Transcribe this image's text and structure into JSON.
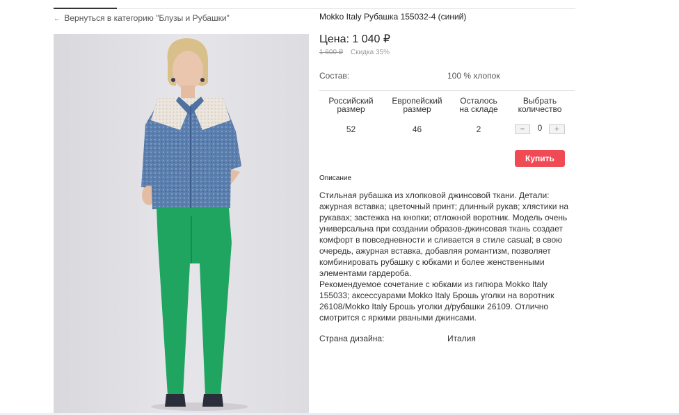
{
  "navigation": {
    "back_arrow": "←",
    "back_label": "Вернуться в категорию \"Блузы и Рубашки\""
  },
  "product": {
    "title": "Mokko Italy Рубашка 155032-4 (синий)",
    "price": "Цена: 1 040 ₽",
    "old_price": "1 600 ₽",
    "discount": "Скидка 35%",
    "composition_label": "Состав:",
    "composition_value": "100 % хлопок",
    "image": {
      "icon": "product-photo",
      "colors": {
        "shirt": "#5b7fae",
        "lace": "#ece6de",
        "pants": "#1fa560",
        "shoes": "#2a2d3a",
        "background": "#e1e0e4"
      }
    }
  },
  "size_table": {
    "headers": [
      "Российский\nразмер",
      "Европейский\nразмер",
      "Осталось\nна складе",
      "Выбрать\nколичество"
    ],
    "row": {
      "ru_size": "52",
      "eu_size": "46",
      "stock": "2"
    },
    "quantity": {
      "minus": "−",
      "value": "0",
      "plus": "+"
    }
  },
  "buy_button": {
    "label": "Купить",
    "color": "#f04a55"
  },
  "description": {
    "heading": "Описание",
    "text": "Стильная рубашка из хлопковой джинсовой ткани. Детали: ажурная вставка; цветочный принт; длинный рукав; хлястики на рукавах; застежка на кнопки; отложной воротник. Модель очень универсальна при создании образов-джинсовая ткань создает комфорт в повседневности и сливается в стиле casual; в свою очередь, ажурная вставка, добавляя романтизм, позволяет комбинировать рубашку с юбками и более женственными элементами гардероба.\nРекомендуемое сочетание с юбками из гипюра Mokko Italy 155033; аксессуарами Mokko Italy Брошь уголки на воротник 26108/Mokko Italy Брошь уголки д/рубашки 26109. Отлично смотрится с яркими рваными джинсами."
  },
  "country": {
    "label": "Страна дизайна:",
    "value": "Италия"
  }
}
